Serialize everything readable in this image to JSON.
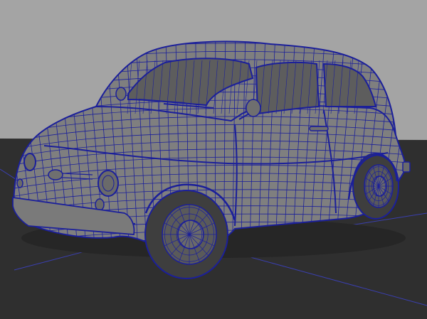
{
  "viewport": {
    "background_color": "#a4a4a4",
    "ground_color": "#2f2f2f",
    "grid_line_color": "#3a3fb0",
    "shaded_body_color": "#7f7f7f",
    "wire_color": "#1b1f9a",
    "tire_color": "#3e3e3e",
    "glass_color": "#5d5d5d"
  }
}
